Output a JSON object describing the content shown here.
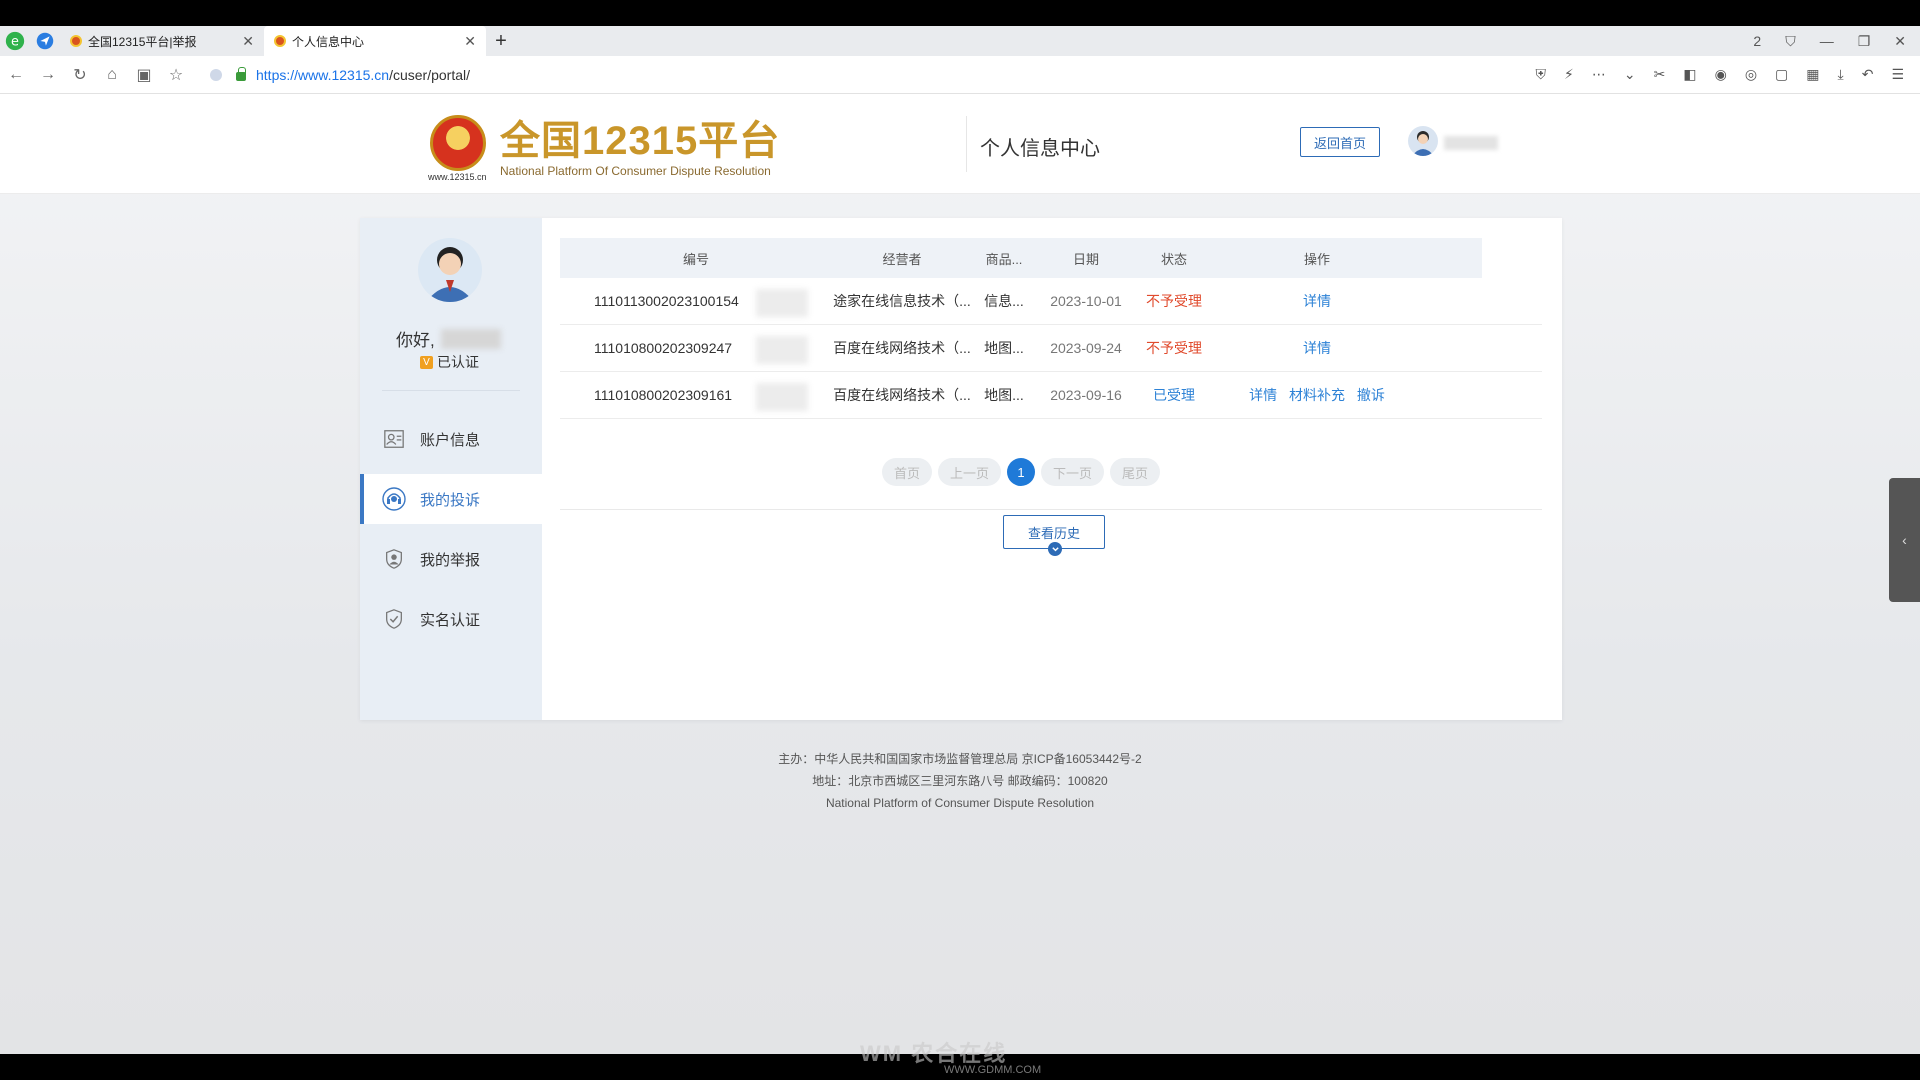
{
  "browser": {
    "tabs": [
      {
        "title": "全国12315平台|举报"
      },
      {
        "title": "个人信息中心"
      }
    ],
    "url_host": "https://www.12315.cn",
    "url_path": "/cuser/portal/",
    "window_counter": "2"
  },
  "header": {
    "logo_title": "全国12315平台",
    "logo_subtitle": "National Platform Of Consumer Dispute Resolution",
    "emblem_caption": "www.12315.cn",
    "center_title": "个人信息中心",
    "home_button": "返回首页"
  },
  "sidebar": {
    "greeting": "你好,",
    "verified_badge": "V",
    "verified_text": "已认证",
    "items": [
      {
        "label": "账户信息",
        "icon": "account-card-icon"
      },
      {
        "label": "我的投诉",
        "icon": "headset-icon",
        "active": true
      },
      {
        "label": "我的举报",
        "icon": "badge-report-icon"
      },
      {
        "label": "实名认证",
        "icon": "shield-check-icon"
      }
    ]
  },
  "table": {
    "headers": [
      "编号",
      "经营者",
      "商品...",
      "日期",
      "状态",
      "操作"
    ],
    "rows": [
      {
        "id": "1110113002023100154",
        "operator": "途家在线信息技术（...",
        "product": "信息...",
        "date": "2023-10-01",
        "status": "不予受理",
        "status_color": "#e04a2c",
        "actions": [
          "详情"
        ]
      },
      {
        "id": "111010800202309247",
        "operator": "百度在线网络技术（...",
        "product": "地图...",
        "date": "2023-09-24",
        "status": "不予受理",
        "status_color": "#e04a2c",
        "actions": [
          "详情"
        ]
      },
      {
        "id": "111010800202309161",
        "operator": "百度在线网络技术（...",
        "product": "地图...",
        "date": "2023-09-16",
        "status": "已受理",
        "status_color": "#2d82d6",
        "actions": [
          "详情",
          "材料补充",
          "撤诉"
        ]
      }
    ]
  },
  "pager": {
    "first": "首页",
    "prev": "上一页",
    "current": "1",
    "next": "下一页",
    "last": "尾页"
  },
  "history_button": "查看历史",
  "footer": {
    "line1": "主办：中华人民共和国国家市场监督管理总局 京ICP备16053442号-2",
    "line2": "地址：北京市西城区三里河东路八号 邮政编码：100820",
    "line3": "National Platform of Consumer Dispute Resolution"
  },
  "watermark": {
    "main": "WM 农合在线",
    "sub": "WWW.GDMM.COM"
  },
  "colors": {
    "accent": "#2d6bb6",
    "reject": "#e04a2c",
    "accepted": "#2d82d6",
    "logo_gold": "#c9962a"
  }
}
